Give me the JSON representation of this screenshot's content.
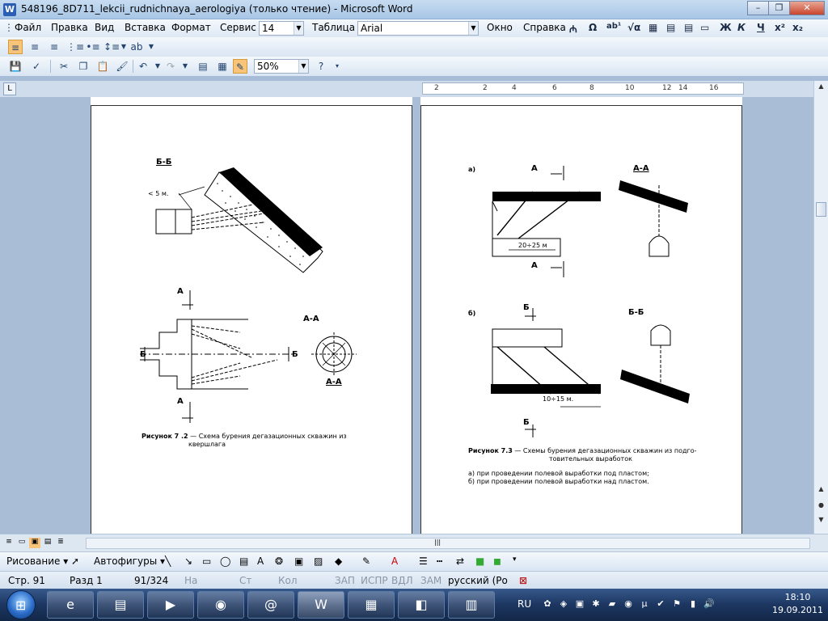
{
  "window": {
    "title": "548196_8D711_lekcii_rudnichnaya_aerologiya (только чтение) - Microsoft Word",
    "app_icon": "W",
    "minimize": "–",
    "restore": "❐",
    "close": "✕"
  },
  "menu": {
    "items": [
      "Файл",
      "Правка",
      "Вид",
      "Вставка",
      "Формат",
      "Сервис"
    ],
    "font_size": "14",
    "table": "Таблица",
    "font_name": "Arial",
    "window": "Окно",
    "help": "Справка",
    "bold": "Ж",
    "italic": "К",
    "underline": "Ч"
  },
  "toolbar": {
    "zoom": "50%"
  },
  "ruler": {
    "ticks": [
      "2",
      "2",
      "4",
      "6",
      "8",
      "10",
      "12",
      "14",
      "16"
    ]
  },
  "page_left": {
    "section_bb": "Б-Б",
    "dist_label": "< 5 м.",
    "label_a_top": "А",
    "label_a_bottom": "А",
    "label_b_left": "Б",
    "label_b_right": "Б",
    "section_aa": "А-А",
    "section_aa2": "А-А",
    "caption_lead": "Рисунок 7 .2",
    "caption_text": " — Схема бурения дегазационных скважин из",
    "caption_text2": "квершлага"
  },
  "page_right": {
    "label_a_part": "а)",
    "label_a1": "А",
    "section_aa": "А-А",
    "dim_a": "20÷25 м",
    "label_a2": "А",
    "label_b_part": "б)",
    "label_b1": "Б",
    "section_bb": "Б-Б",
    "dim_b": "10÷15 м.",
    "label_b2": "Б",
    "caption_lead": "Рисунок 7.3",
    "caption_text": " — Схемы бурения дегазационных скважин из подго-",
    "caption_text2": "товительных выработок",
    "note1": "а) при проведении полевой выработки под пластом;",
    "note2": "б) при проведении полевой выработки над пластом."
  },
  "drawbar": {
    "drawing": "Рисование ▾",
    "autoshapes": "Автофигуры ▾"
  },
  "status": {
    "page": "Стр.  91",
    "section": "Разд  1",
    "pages": "91/324",
    "at": "На",
    "line": "Ст",
    "col": "Кол",
    "rec": "ЗАП",
    "trk": "ИСПР",
    "ext": "ВДЛ",
    "ovr": "ЗАМ",
    "lang": "русский (Ро"
  },
  "taskbar": {
    "lang": "RU",
    "time": "18:10",
    "date": "19.09.2011"
  }
}
